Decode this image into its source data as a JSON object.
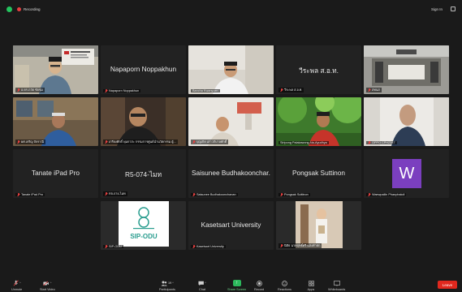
{
  "topbar": {
    "recording_label": "Recording",
    "signin_label": "Sign In"
  },
  "tiles": [
    {
      "name": "อ.ดร.ภวัต ชัยชุ่ม",
      "big": "",
      "slide": "CHULA ENGINEERING"
    },
    {
      "name": "Napaporn Noppakhun",
      "big": "Napaporn Noppakhun"
    },
    {
      "name": "Bancha Kwanyuen",
      "big": ""
    },
    {
      "name": "วีระพล ส.อ.ท.",
      "big": "วีระพล ส.อ.ท."
    },
    {
      "name": "สทนส",
      "big": ""
    },
    {
      "name": "ผศ.เจริญ ปัจราณี",
      "big": ""
    },
    {
      "name": "เกรียงศักดิ์ พุ่มกาสะ กรรมการศูนย์นำนวัตกรรม ผู้...",
      "big": ""
    },
    {
      "name": "บุญเกิด เสาวภิบาลศักดิ์",
      "big": ""
    },
    {
      "name": "Siripong Palakawong-Na-Ayudhya",
      "big": ""
    },
    {
      "name": "OPPO CPH2387",
      "big": ""
    },
    {
      "name": "Tanate iPad Pro",
      "big": "Tanate iPad Pro"
    },
    {
      "name": "R5-074-ไมท",
      "big": "R5-074-ไมท"
    },
    {
      "name": "Saisunee Budhakoonchanan",
      "big": "Saisunee Budhakoonchar..."
    },
    {
      "name": "Pongsak Suttinon",
      "big": "Pongsak Suttinon"
    },
    {
      "name": "Waewpailin Phanphakdi",
      "big": "",
      "avatar": "W"
    },
    {
      "name": "SIP-ODU",
      "big": "",
      "logo": "SIP-ODU"
    },
    {
      "name": "Kasetsart University",
      "big": "Kasetsart University"
    },
    {
      "name": "นิติธ นาคฤทธิ์ศรี แสงคำพัก",
      "big": ""
    }
  ],
  "toolbar": {
    "unmute": "Unmute",
    "start_video": "Start Video",
    "participants": "Participants",
    "participants_count": "19",
    "chat": "Chat",
    "share_screen": "Share Screen",
    "record": "Record",
    "reactions": "Reactions",
    "apps": "Apps",
    "whiteboards": "Whiteboards",
    "leave": "Leave"
  },
  "colors": {
    "share": "#2cb85c",
    "leave": "#e0281e",
    "speaking": "#7dd948",
    "avatar": "#7b3fbf"
  }
}
